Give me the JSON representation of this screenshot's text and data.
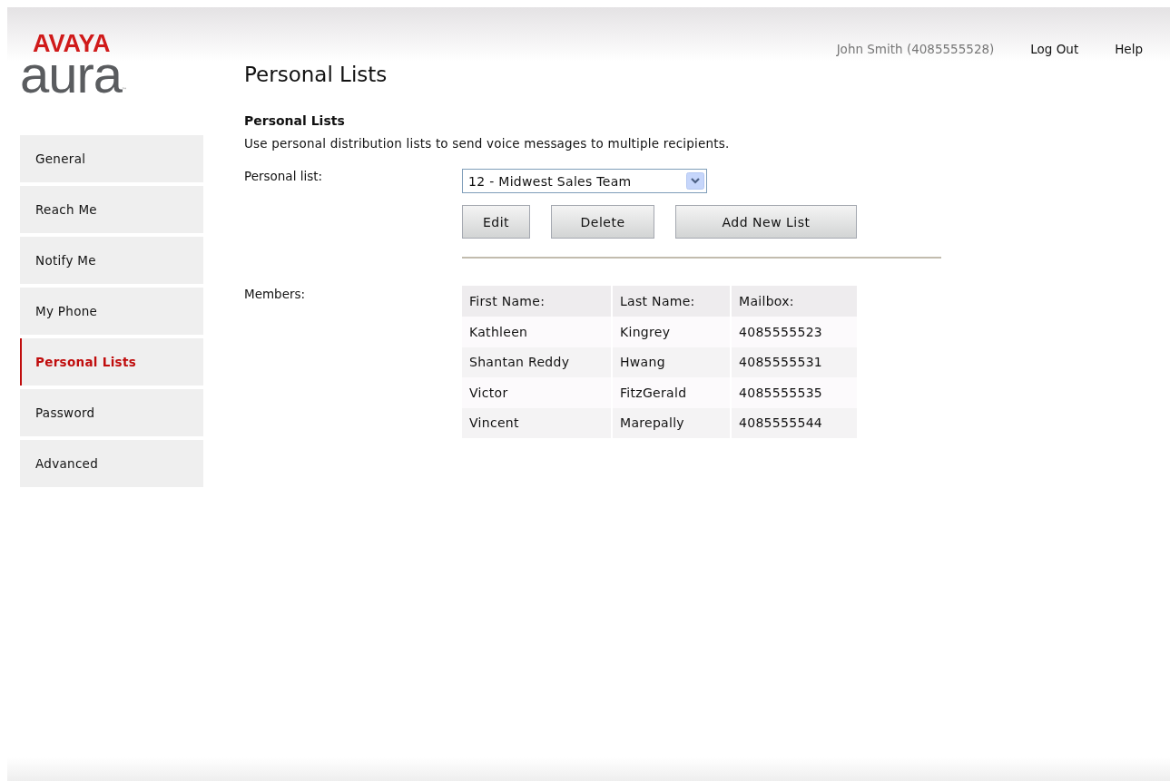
{
  "logo": {
    "brand": "AVAYA",
    "product": "aura",
    "mark": "™"
  },
  "header": {
    "user": "John Smith (4085555528)",
    "links": [
      "Log Out",
      "Help"
    ]
  },
  "sidebar": {
    "items": [
      {
        "label": "General",
        "selected": false
      },
      {
        "label": "Reach Me",
        "selected": false
      },
      {
        "label": "Notify Me",
        "selected": false
      },
      {
        "label": "My Phone",
        "selected": false
      },
      {
        "label": "Personal Lists",
        "selected": true
      },
      {
        "label": "Password",
        "selected": false
      },
      {
        "label": "Advanced",
        "selected": false
      }
    ]
  },
  "page_title": "Personal Lists",
  "section": {
    "title": "Personal Lists",
    "description": "Use personal distribution lists to send voice messages to multiple recipients."
  },
  "personal_list": {
    "label": "Personal list:",
    "value": "12 - Midwest Sales Team"
  },
  "buttons": [
    "Edit",
    "Delete",
    "Add New List"
  ],
  "members": {
    "label": "Members:",
    "columns": [
      "First Name:",
      "Last Name:",
      "Mailbox:"
    ],
    "rows": [
      [
        "Kathleen",
        "Kingrey",
        "4085555523"
      ],
      [
        "Shantan Reddy",
        "Hwang",
        "4085555531"
      ],
      [
        "Victor",
        "FitzGerald",
        "4085555535"
      ],
      [
        "Vincent",
        "Marepally",
        "4085555544"
      ]
    ]
  }
}
